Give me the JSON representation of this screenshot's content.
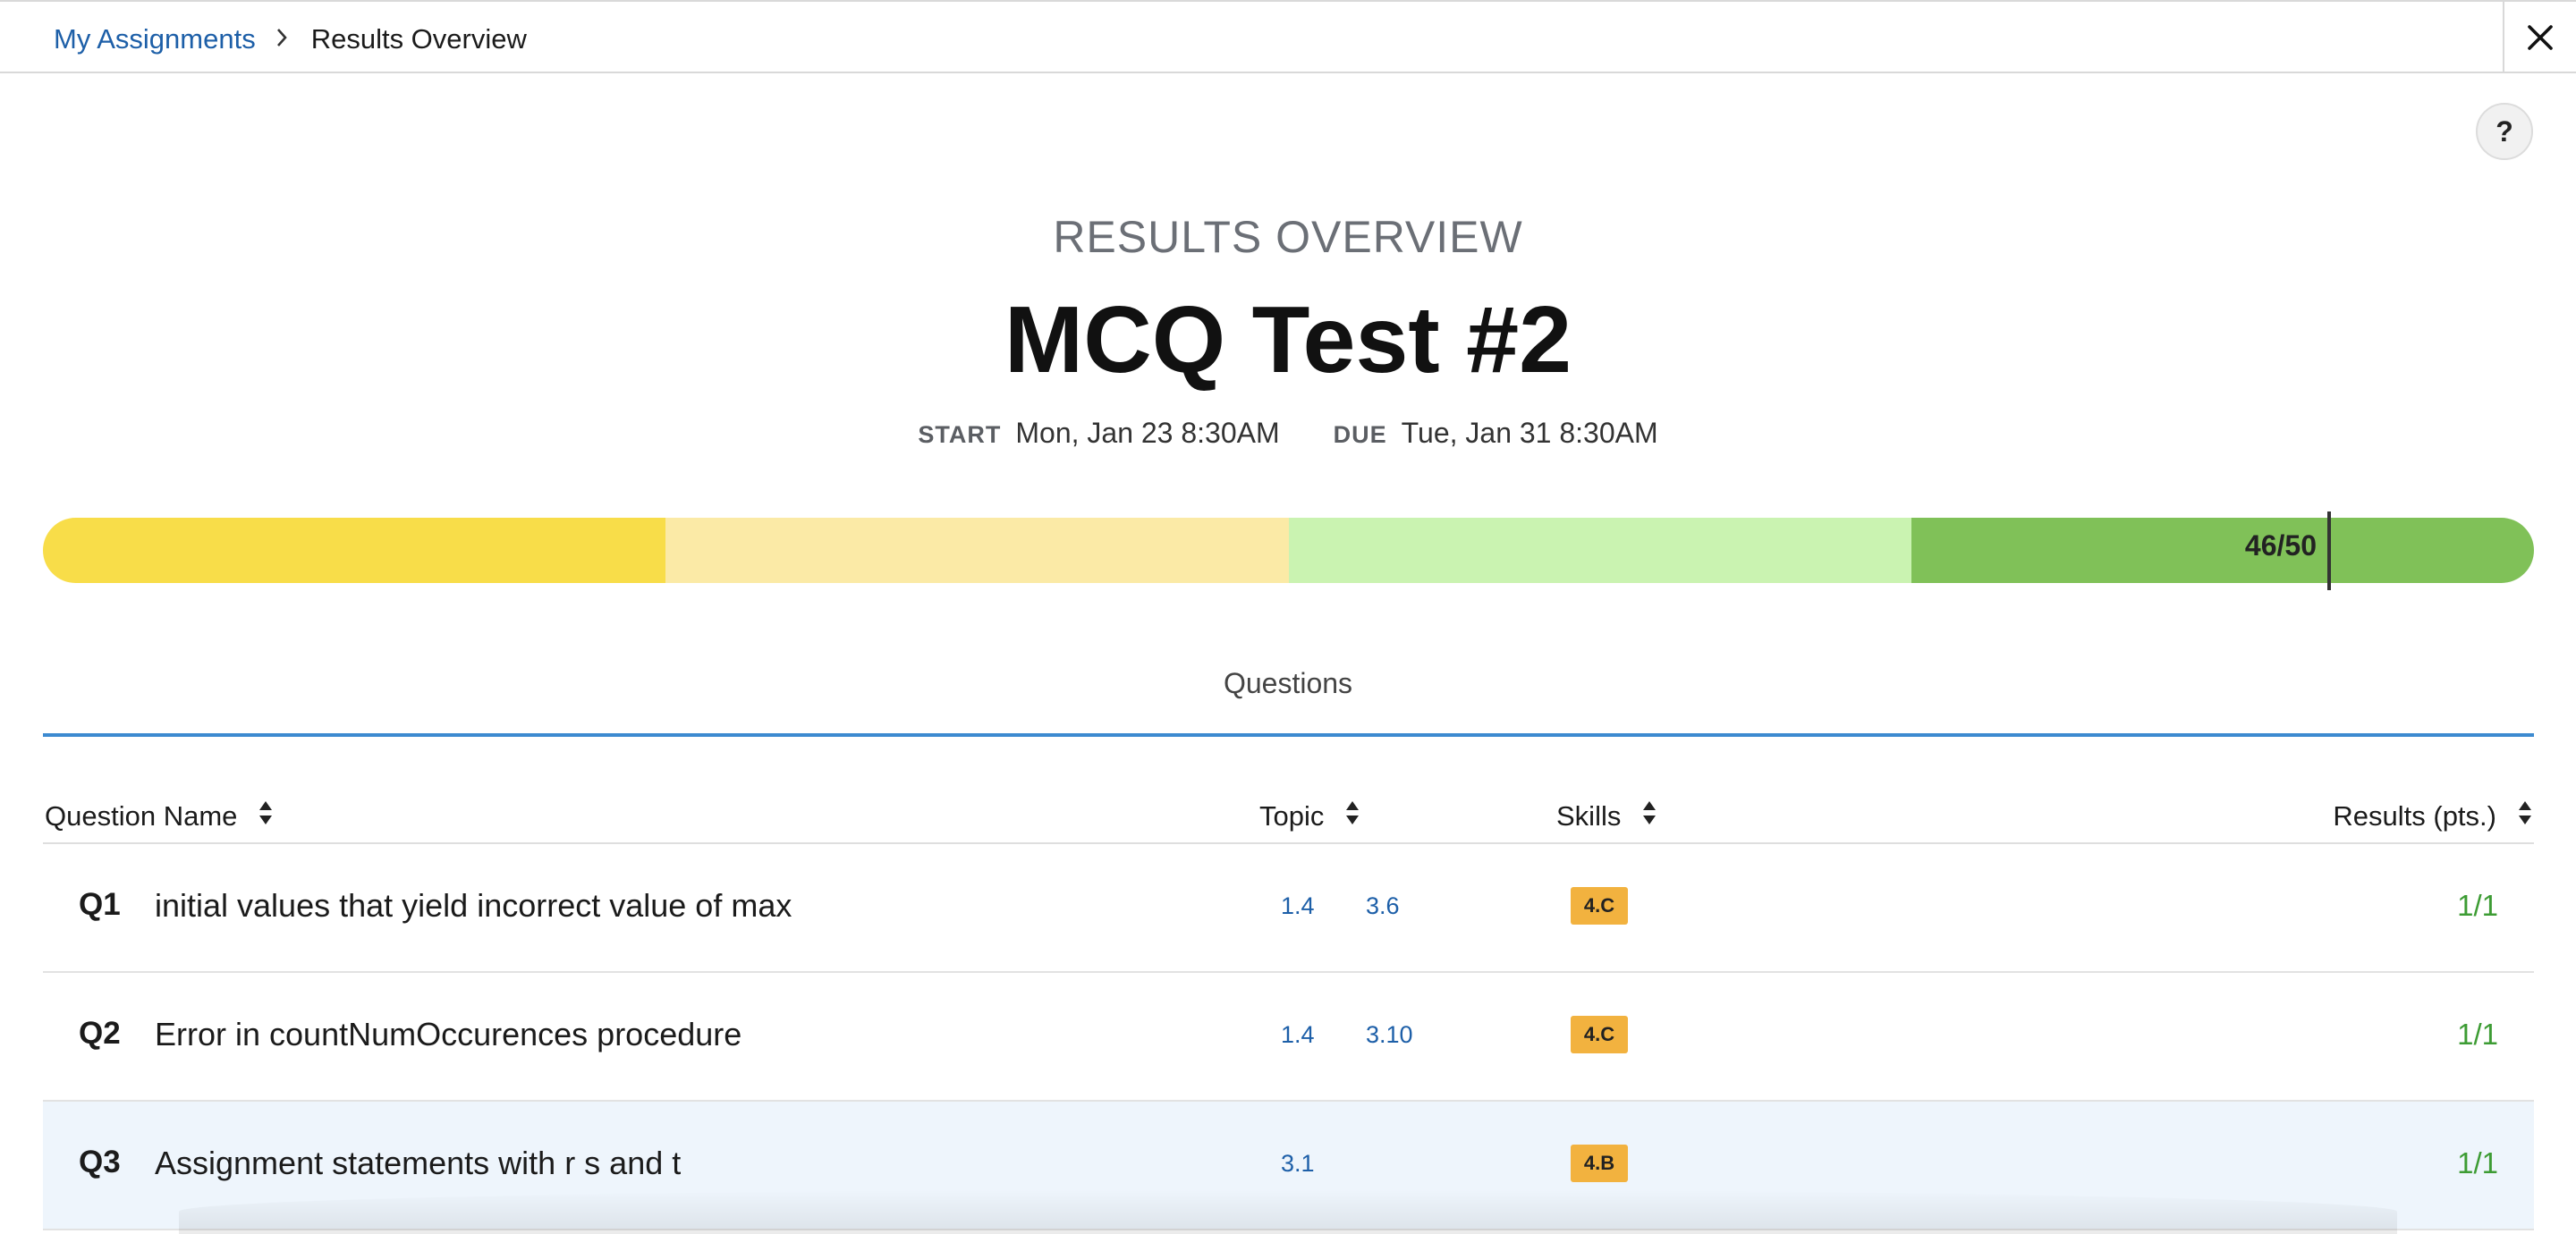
{
  "breadcrumb": {
    "parent": "My Assignments",
    "separator": ">",
    "current": "Results Overview"
  },
  "help_label": "?",
  "header": {
    "eyebrow": "RESULTS OVERVIEW",
    "title": "MCQ Test #2",
    "start_label": "START",
    "start_value": "Mon, Jan 23 8:30AM",
    "due_label": "DUE",
    "due_value": "Tue, Jan 31 8:30AM"
  },
  "score": {
    "label": "46/50",
    "earned": 46,
    "total": 50,
    "bands": [
      {
        "color": "#f8dd49"
      },
      {
        "color": "#fbeaa6"
      },
      {
        "color": "#caf3b1"
      },
      {
        "color": "#80c158"
      }
    ]
  },
  "tabs": {
    "questions": "Questions"
  },
  "table": {
    "columns": {
      "name": "Question Name",
      "topic": "Topic",
      "skills": "Skills",
      "results": "Results (pts.)"
    },
    "rows": [
      {
        "num": "Q1",
        "name": "initial values that yield incorrect value of max",
        "topic1": "1.4",
        "topic2": "3.6",
        "skill": "4.C",
        "result": "1/1"
      },
      {
        "num": "Q2",
        "name": "Error in countNumOccurences procedure",
        "topic1": "1.4",
        "topic2": "3.10",
        "skill": "4.C",
        "result": "1/1"
      },
      {
        "num": "Q3",
        "name": "Assignment statements with r s and t",
        "topic1": "3.1",
        "topic2": "",
        "skill": "4.B",
        "result": "1/1"
      }
    ]
  },
  "colors": {
    "link": "#1d5fa8",
    "accent_line": "#3c8ad0",
    "skill_badge": "#f2b23f",
    "result_green": "#3d9c34",
    "highlight_row": "#eef5fc"
  }
}
